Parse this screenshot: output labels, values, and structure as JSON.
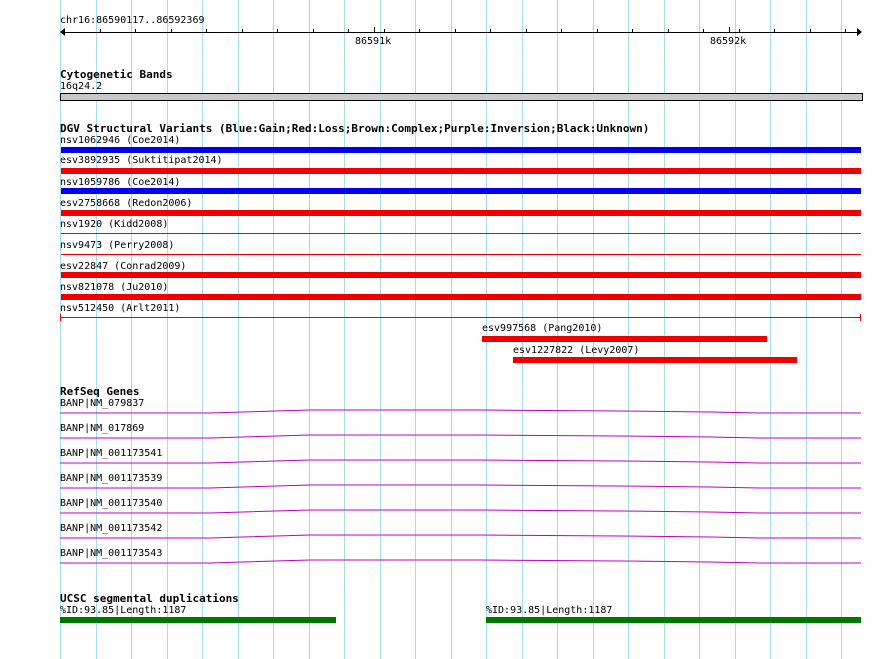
{
  "ruler": {
    "region": "chr16:86590117..86592369",
    "label_left": "86591k",
    "label_right": "86592k"
  },
  "cytoband": {
    "title": "Cytogenetic Bands",
    "band": "16q24.2"
  },
  "dgv": {
    "title": "DGV Structural Variants (Blue:Gain;Red:Loss;Brown:Complex;Purple:Inversion;Black:Unknown)",
    "variants": [
      {
        "label": "nsv1062946 (Coe2014)",
        "type": "Gain",
        "color": "#0000ee"
      },
      {
        "label": "esv3892935 (Suktitipat2014)",
        "type": "Loss",
        "color": "#ee0000"
      },
      {
        "label": "nsv1059786 (Coe2014)",
        "type": "Gain",
        "color": "#0000ee"
      },
      {
        "label": "esv2758668 (Redon2006)",
        "type": "Loss",
        "color": "#ee0000"
      },
      {
        "label": "nsv1920 (Kidd2008)",
        "type": "Loss",
        "color": "#ee0000"
      },
      {
        "label": "nsv9473 (Perry2008)",
        "type": "Loss",
        "color": "#ee0000"
      },
      {
        "label": "esv22847 (Conrad2009)",
        "type": "Loss",
        "color": "#ee0000"
      },
      {
        "label": "nsv821078 (Ju2010)",
        "type": "Loss",
        "color": "#ee0000"
      },
      {
        "label": "nsv512450 (Arlt2011)",
        "type": "Loss",
        "color": "#ee0000"
      },
      {
        "label": "esv997568 (Pang2010)",
        "type": "Loss",
        "color": "#ee0000"
      },
      {
        "label": "esv1227822 (Levy2007)",
        "type": "Loss",
        "color": "#ee0000"
      }
    ]
  },
  "refseq": {
    "title": "RefSeq Genes",
    "color": "#c000c0",
    "genes": [
      {
        "label": "BANP|NM_079837"
      },
      {
        "label": "BANP|NM_017869"
      },
      {
        "label": "BANP|NM_001173541"
      },
      {
        "label": "BANP|NM_001173539"
      },
      {
        "label": "BANP|NM_001173540"
      },
      {
        "label": "BANP|NM_001173542"
      },
      {
        "label": "BANP|NM_001173543"
      }
    ]
  },
  "segdup": {
    "title": "UCSC segmental duplications",
    "color": "#007700",
    "items": [
      {
        "label": "%ID:93.85|Length:1187"
      },
      {
        "label": "%ID:93.85|Length:1187"
      }
    ]
  },
  "colors": {
    "gridline": "#a8dcea",
    "cytoband_fill": "#c8c8c8"
  }
}
